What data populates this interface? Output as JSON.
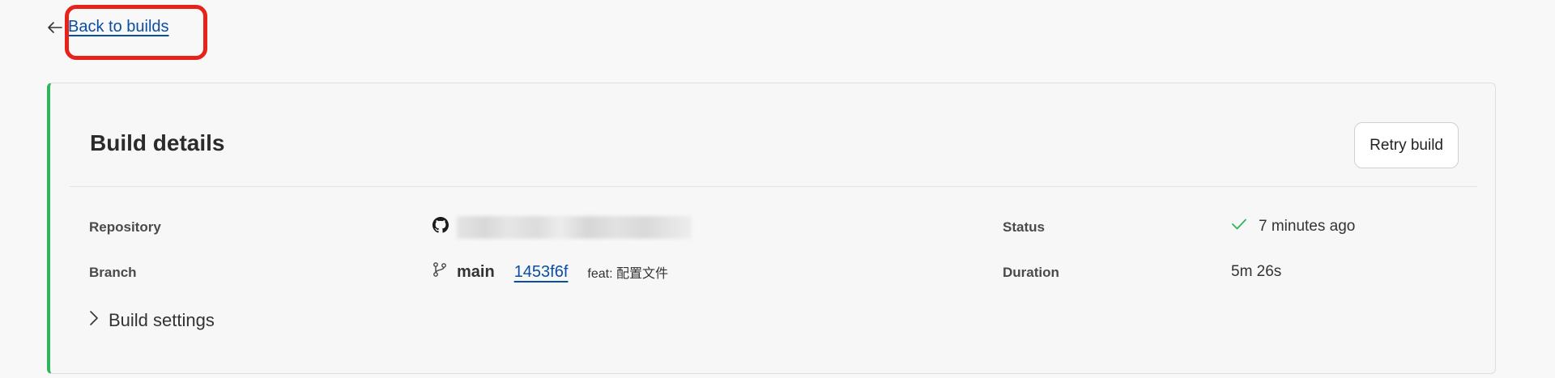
{
  "nav": {
    "back_label": "Back to builds"
  },
  "card": {
    "title": "Build details",
    "retry_label": "Retry build",
    "accent_color": "#2fb55d",
    "repository": {
      "label": "Repository",
      "icon": "github-icon"
    },
    "branch": {
      "label": "Branch",
      "icon": "git-branch-icon",
      "name": "main",
      "commit": "1453f6f",
      "commit_message": "feat: 配置文件"
    },
    "status": {
      "label": "Status",
      "icon": "check-icon",
      "value": "7 minutes ago",
      "color": "#2fb55d"
    },
    "duration": {
      "label": "Duration",
      "value": "5m 26s"
    },
    "settings_label": "Build settings"
  },
  "colors": {
    "link": "#0a4ea3",
    "annotation": "#e8211a"
  }
}
